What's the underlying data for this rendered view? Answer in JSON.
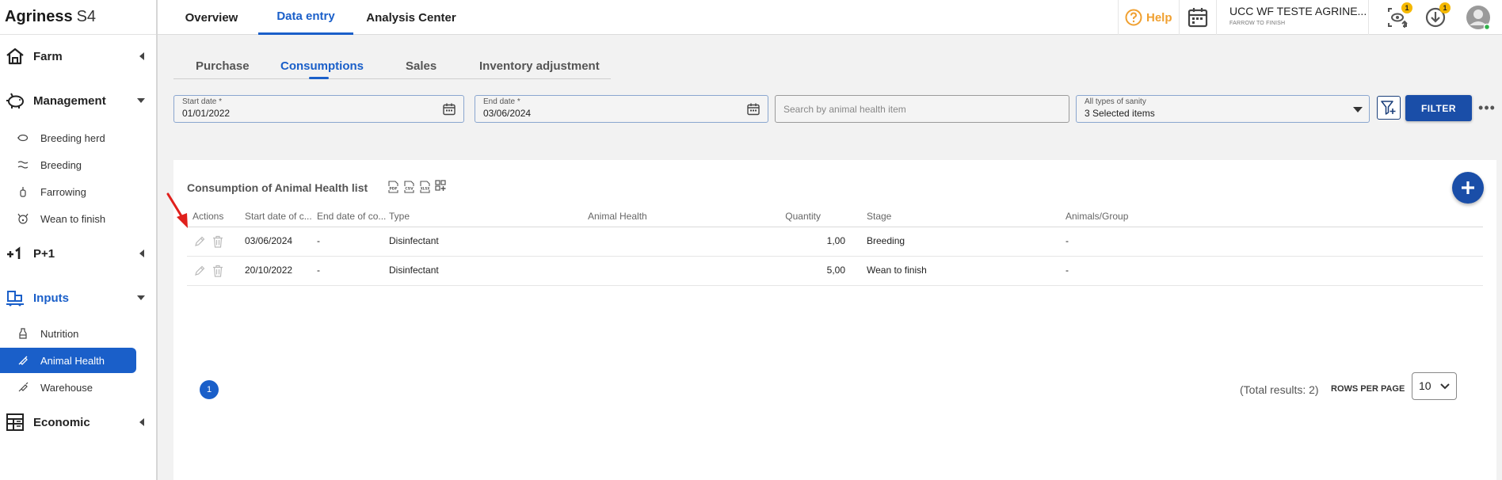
{
  "app": {
    "brand": "Agriness",
    "brand_suffix": "S4"
  },
  "top_tabs": [
    {
      "label": "Overview"
    },
    {
      "label": "Data entry"
    },
    {
      "label": "Analysis Center"
    }
  ],
  "topbar": {
    "help_label": "Help",
    "farm_name": "UCC WF TESTE AGRINE...",
    "farm_type": "FARROW TO FINISH",
    "badge_monitor": "1",
    "badge_download": "1"
  },
  "sidebar": {
    "farm": "Farm",
    "management": "Management",
    "management_items": [
      "Breeding herd",
      "Breeding",
      "Farrowing",
      "Wean to finish"
    ],
    "p1": "P+1",
    "inputs": "Inputs",
    "inputs_items": [
      "Nutrition",
      "Animal Health",
      "Warehouse"
    ],
    "economic": "Economic"
  },
  "sub_tabs": [
    {
      "label": "Purchase"
    },
    {
      "label": "Consumptions"
    },
    {
      "label": "Sales"
    },
    {
      "label": "Inventory adjustment"
    }
  ],
  "filters": {
    "start_label": "Start date *",
    "start_value": "01/01/2022",
    "end_label": "End date *",
    "end_value": "03/06/2024",
    "search_placeholder": "Search by animal health item",
    "sanity_label": "All types of sanity",
    "sanity_value": "3 Selected items",
    "filter_button": "FILTER",
    "more": "•••"
  },
  "list": {
    "title": "Consumption of Animal Health list",
    "export_icons": [
      "pdf-icon",
      "csv-icon",
      "xlsx-icon",
      "columns-icon"
    ],
    "columns": [
      "Actions",
      "Start date of c...",
      "End date of co...",
      "Type",
      "Animal Health",
      "Quantity",
      "Stage",
      "Animals/Group"
    ],
    "rows": [
      {
        "start": "03/06/2024",
        "end": "-",
        "type": "Disinfectant",
        "animal_health": "",
        "quantity": "1,00",
        "stage": "Breeding",
        "animals": "-"
      },
      {
        "start": "20/10/2022",
        "end": "-",
        "type": "Disinfectant",
        "animal_health": "",
        "quantity": "5,00",
        "stage": "Wean to finish",
        "animals": "-"
      }
    ]
  },
  "pagination": {
    "current_page": "1",
    "total": "(Total results: 2)",
    "rows_per_page_label": "ROWS PER PAGE",
    "rows_per_page_value": "10"
  },
  "colors": {
    "accent": "#1a5fc9",
    "filter_button": "#1a4ea8",
    "help": "#f0a030",
    "badge": "#f5b800",
    "annotation_arrow": "#e0201c"
  }
}
